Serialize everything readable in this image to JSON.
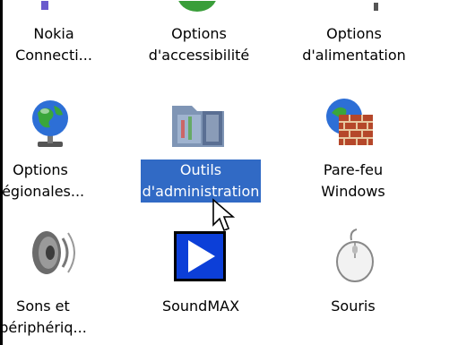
{
  "items": [
    {
      "id": "nokia",
      "line1": "Nokia",
      "line2": "Connecti...",
      "icon": "nokia-icon"
    },
    {
      "id": "accessibility",
      "line1": "Options",
      "line2": "d'accessibilité",
      "icon": "accessibility-icon"
    },
    {
      "id": "power",
      "line1": "Options",
      "line2": "d'alimentation",
      "icon": "power-options-icon"
    },
    {
      "id": "regional",
      "line1": "Options",
      "line2": "régionales...",
      "icon": "globe-icon"
    },
    {
      "id": "admin",
      "line1": "Outils",
      "line2": "d'administration",
      "icon": "admin-tools-icon"
    },
    {
      "id": "firewall",
      "line1": "Pare-feu",
      "line2": "Windows",
      "icon": "firewall-icon"
    },
    {
      "id": "sounds",
      "line1": "Sons et",
      "line2": "périphériq...",
      "icon": "speaker-icon"
    },
    {
      "id": "soundmax",
      "line1": "SoundMAX",
      "line2": "",
      "icon": "soundmax-play-icon"
    },
    {
      "id": "mouse",
      "line1": "Souris",
      "line2": "",
      "icon": "mouse-icon"
    }
  ],
  "colors": {
    "selection": "#316ac5"
  }
}
